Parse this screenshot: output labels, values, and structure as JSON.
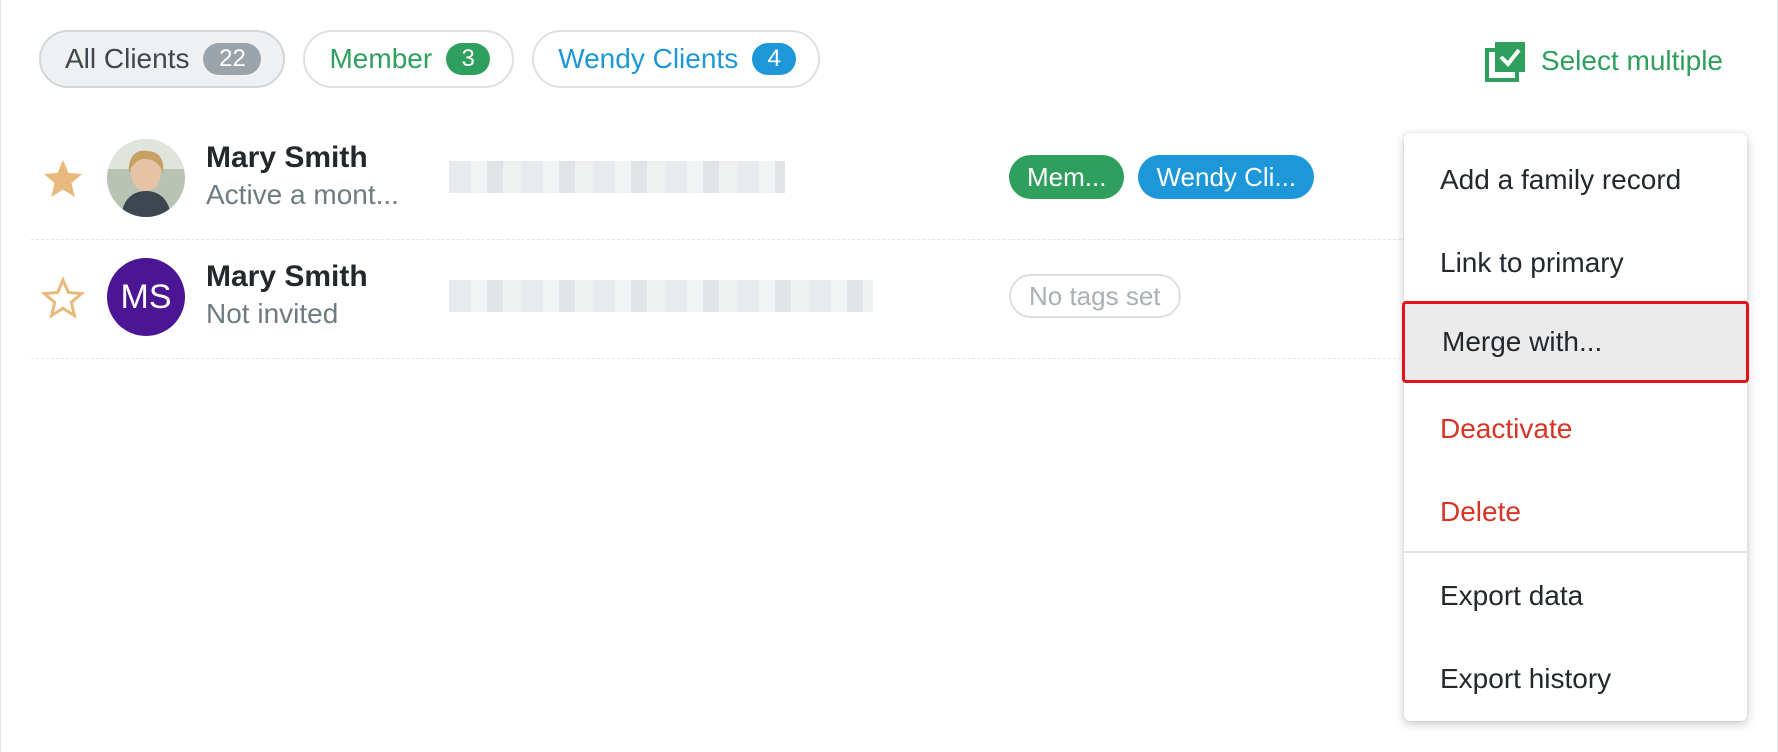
{
  "filters": [
    {
      "label": "All Clients",
      "count": "22"
    },
    {
      "label": "Member",
      "count": "3"
    },
    {
      "label": "Wendy Clients",
      "count": "4"
    }
  ],
  "select_multiple": {
    "label": "Select multiple",
    "icon": "checklist-icon"
  },
  "clients": [
    {
      "name": "Mary Smith",
      "status": "Active a mont...",
      "starred": true,
      "avatar": "photo",
      "tags": [
        "Mem...",
        "Wendy Cli..."
      ]
    },
    {
      "name": "Mary Smith",
      "status": "Not invited",
      "starred": false,
      "avatar_initials": "MS",
      "tags_empty": "No tags set"
    }
  ],
  "menu": {
    "items": [
      {
        "label": "Add a family record"
      },
      {
        "label": "Link to primary"
      },
      {
        "label": "Merge with..."
      },
      {
        "label": "Deactivate"
      },
      {
        "label": "Delete"
      },
      {
        "label": "Export data"
      },
      {
        "label": "Export history"
      }
    ]
  },
  "colors": {
    "member_green": "#2e9f5d",
    "wendy_blue": "#1e97d8",
    "danger_red": "#d63424",
    "highlight_outline": "#e3131b",
    "star_gold": "#e8b97c",
    "avatar_purple": "#4b1593"
  }
}
